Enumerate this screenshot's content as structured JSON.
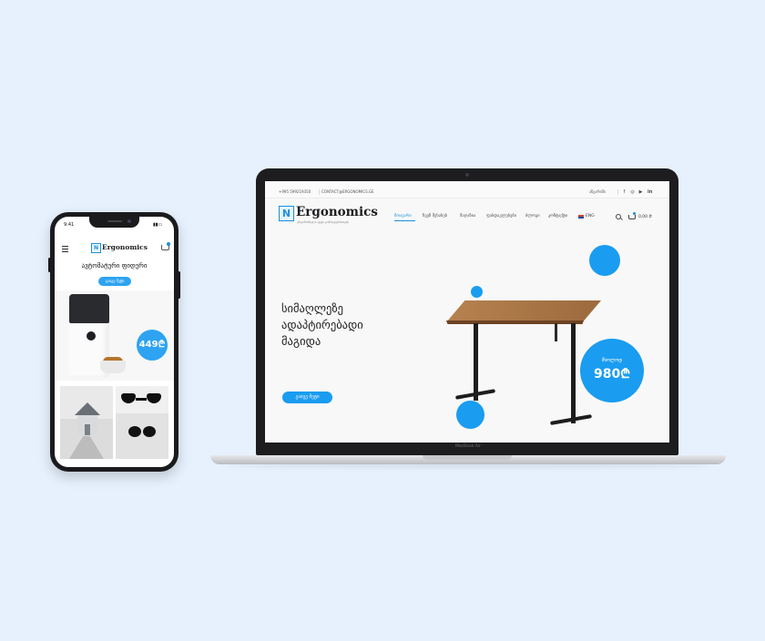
{
  "phone": {
    "status_time": "9:41",
    "brand": "Ergonomics",
    "logo_letter": "N",
    "hero_title": "ავტომატური ფიდერი",
    "hero_button": "გაიგე მეტი",
    "price": "449₾"
  },
  "laptop": {
    "phone": "+995 599219350",
    "email": "CONTACT@ERGONOMICS.GE",
    "account_link": "ანგარიში",
    "brand": "Ergonomics",
    "logo_letter": "N",
    "tagline": "ერგონომიული ავეჯი კომპიუტერისთვის",
    "nav": [
      {
        "label": "მთავარი",
        "active": true
      },
      {
        "label": "ჩვენ შესახებ",
        "active": false
      },
      {
        "label": "მაღაზია",
        "active": false
      },
      {
        "label": "ფასდაკლებები",
        "active": false
      },
      {
        "label": "ბლოგი",
        "active": false
      },
      {
        "label": "კონტაქტი",
        "active": false
      }
    ],
    "language": "ENG",
    "cart_total": "0,00 ₾",
    "hero_title_lines": [
      "სიმაღლეზე",
      "ადაპტირებადი",
      "მაგიდა"
    ],
    "hero_button": "გაიგე მეტი",
    "price_label": "მხოლოდ",
    "price": "980₾",
    "model_label": "MacBook Air"
  },
  "colors": {
    "background": "#e6f1fd",
    "accent": "#1a9cf0",
    "device_frame": "#1d1d1f"
  },
  "icons": [
    "facebook-icon",
    "instagram-icon",
    "youtube-icon",
    "linkedin-icon",
    "search-icon",
    "cart-icon",
    "menu-icon"
  ]
}
